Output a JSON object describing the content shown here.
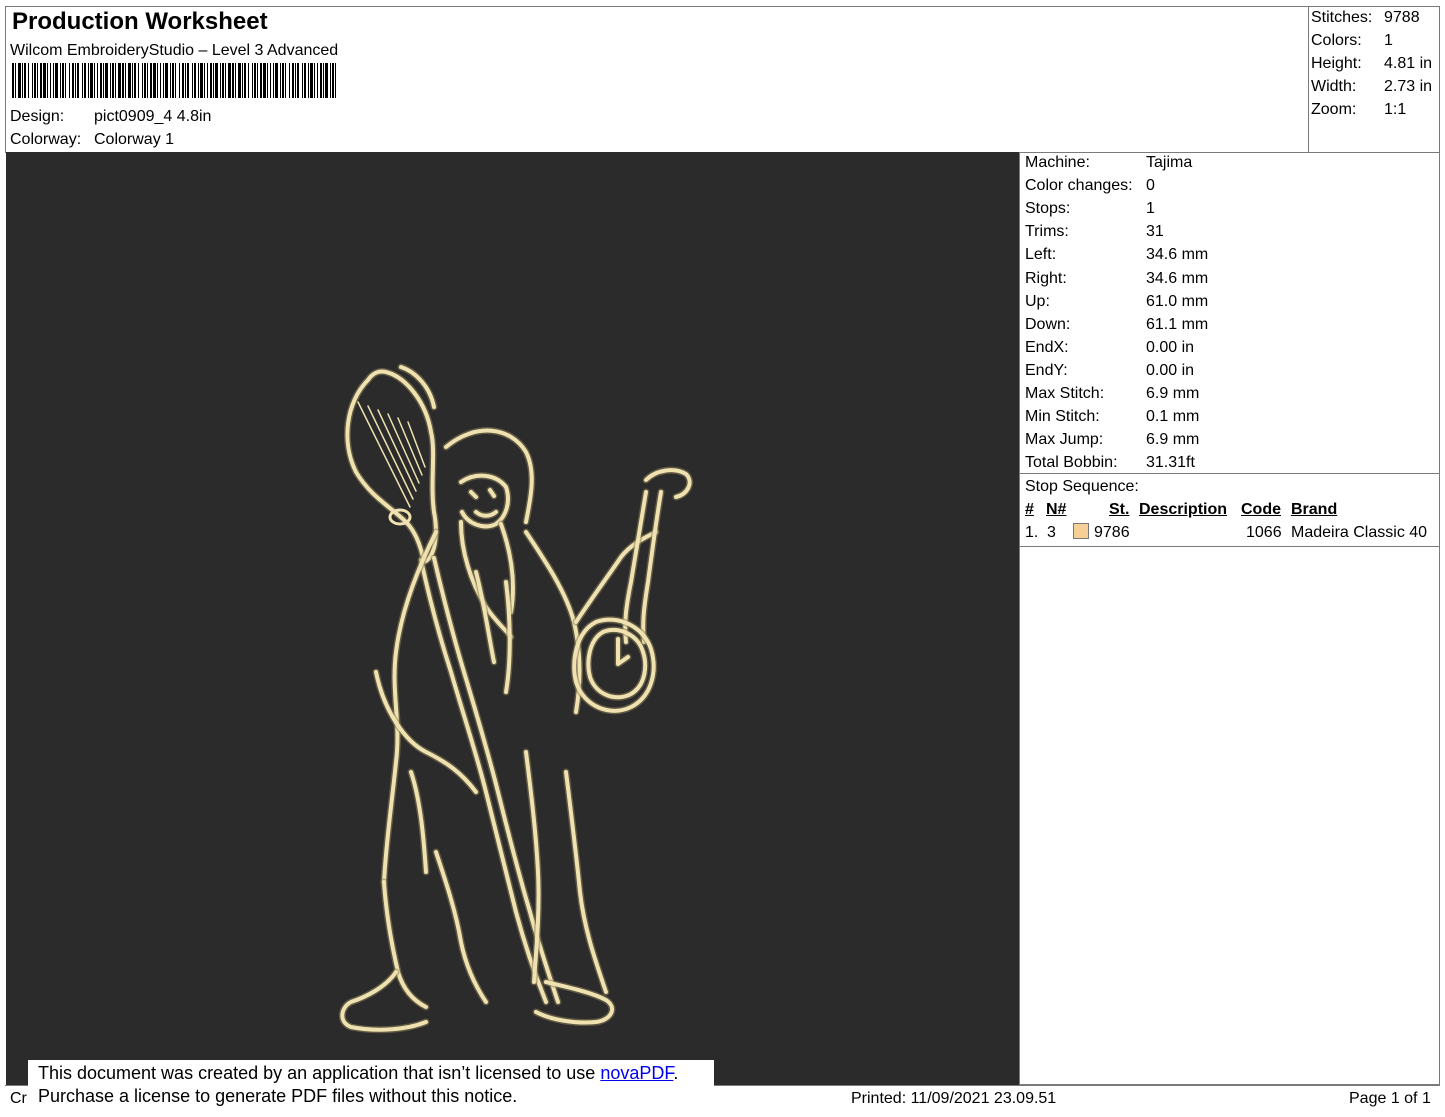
{
  "header": {
    "title": "Production Worksheet",
    "subtitle": "Wilcom EmbroideryStudio – Level 3 Advanced",
    "design_label": "Design:",
    "design_value": "pict0909_4 4.8in",
    "colorway_label": "Colorway:",
    "colorway_value": "Colorway 1"
  },
  "summary": [
    {
      "label": "Stitches:",
      "value": "9788"
    },
    {
      "label": "Colors:",
      "value": "1"
    },
    {
      "label": "Height:",
      "value": "4.81 in"
    },
    {
      "label": "Width:",
      "value": "2.73 in"
    },
    {
      "label": "Zoom:",
      "value": "1:1"
    }
  ],
  "details": [
    {
      "label": "Machine:",
      "value": "Tajima"
    },
    {
      "label": "Color changes:",
      "value": "0"
    },
    {
      "label": "Stops:",
      "value": "1"
    },
    {
      "label": "Trims:",
      "value": "31"
    },
    {
      "label": "Left:",
      "value": "34.6 mm"
    },
    {
      "label": "Right:",
      "value": "34.6 mm"
    },
    {
      "label": "Up:",
      "value": "61.0 mm"
    },
    {
      "label": "Down:",
      "value": "61.1 mm"
    },
    {
      "label": "EndX:",
      "value": "0.00 in"
    },
    {
      "label": "EndY:",
      "value": "0.00 in"
    },
    {
      "label": "Max Stitch:",
      "value": "6.9 mm"
    },
    {
      "label": "Min Stitch:",
      "value": "0.1 mm"
    },
    {
      "label": "Max Jump:",
      "value": "6.9 mm"
    },
    {
      "label": "Total Bobbin:",
      "value": "31.31ft"
    }
  ],
  "stop_sequence": {
    "title": "Stop Sequence:",
    "headers": {
      "num": "#",
      "n": "N#",
      "st": "St.",
      "description": "Description",
      "code": "Code",
      "brand": "Brand"
    },
    "rows": [
      {
        "num": "1.",
        "n": "3",
        "swatch": "#f5cf95",
        "st": "9786",
        "description": "",
        "code": "1066",
        "brand": "Madeira Classic 40"
      }
    ]
  },
  "footer": {
    "left_fragment": "Cr",
    "printed": "Printed: 11/09/2021 23.09.51",
    "page": "Page 1 of 1"
  },
  "notice": {
    "line1_before": "This document was created by an application that isn’t licensed to use ",
    "link": "novaPDF",
    "line1_after": ".",
    "line2": "Purchase a license to generate PDF files without this notice."
  },
  "colors": {
    "fabric": "#2b2b2b",
    "thread": "#efe2b0",
    "thread_shadow": "#8a7d55"
  }
}
